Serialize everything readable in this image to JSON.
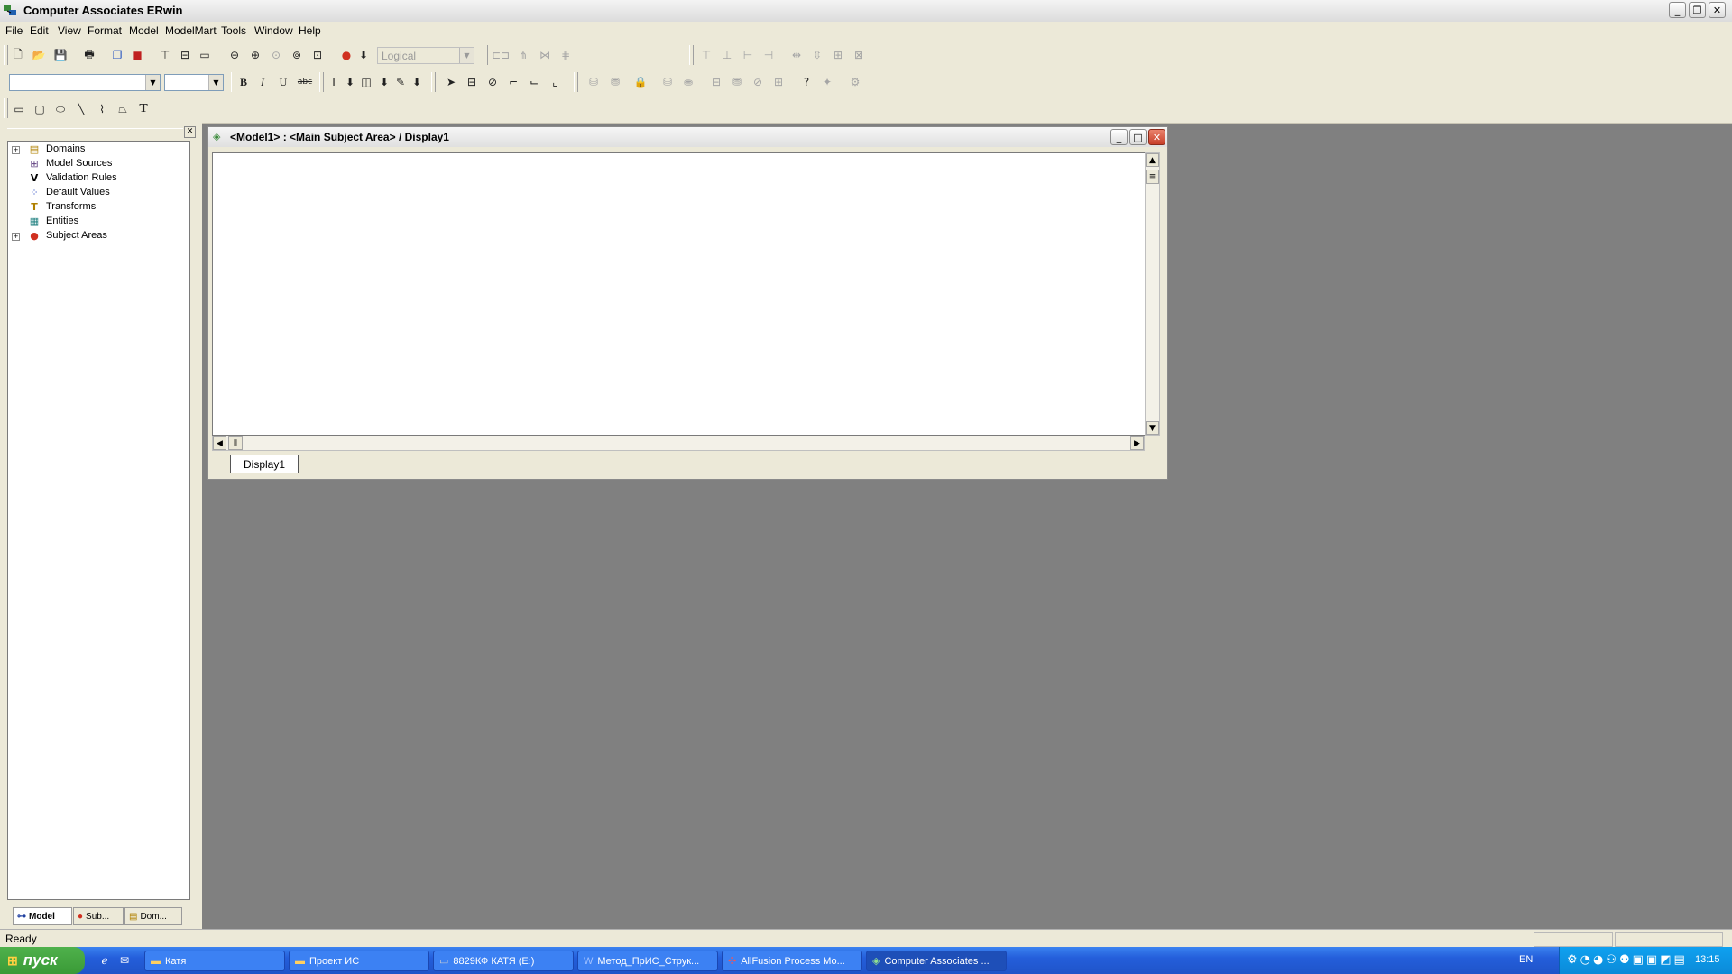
{
  "window": {
    "title": "Computer Associates ERwin",
    "app_icon": "erwin-app-icon",
    "controls": {
      "minimize": "_",
      "restore": "❐",
      "close": "✕"
    }
  },
  "menu": [
    "File",
    "Edit",
    "View",
    "Format",
    "Model",
    "ModelMart",
    "Tools",
    "Window",
    "Help"
  ],
  "toolbar": {
    "model_type_select": "Logical"
  },
  "tree": {
    "items": [
      {
        "label": "Domains",
        "expandable": true,
        "icon": "domains-icon"
      },
      {
        "label": "Model Sources",
        "expandable": false,
        "icon": "model-sources-icon"
      },
      {
        "label": "Validation Rules",
        "expandable": false,
        "icon": "validation-rules-icon"
      },
      {
        "label": "Default Values",
        "expandable": false,
        "icon": "default-values-icon"
      },
      {
        "label": "Transforms",
        "expandable": false,
        "icon": "transforms-icon"
      },
      {
        "label": "Entities",
        "expandable": false,
        "icon": "entities-icon"
      },
      {
        "label": "Subject Areas",
        "expandable": true,
        "icon": "subject-areas-icon"
      }
    ],
    "tabs": [
      "Model",
      "Sub...",
      "Dom..."
    ]
  },
  "diagram_window": {
    "title": "<Model1> : <Main Subject Area> / Display1",
    "tab": "Display1"
  },
  "status": {
    "text": "Ready"
  },
  "taskbar": {
    "start": "пуск",
    "tasks": [
      {
        "label": "Катя",
        "icon": "folder-icon"
      },
      {
        "label": "Проект ИС",
        "icon": "folder-icon"
      },
      {
        "label": "8829КФ КАТЯ (E:)",
        "icon": "drive-icon"
      },
      {
        "label": "Метод_ПрИС_Струк...",
        "icon": "word-doc-icon"
      },
      {
        "label": "AllFusion Process Mo...",
        "icon": "allfusion-icon"
      },
      {
        "label": "Computer Associates ...",
        "icon": "erwin-app-icon"
      }
    ],
    "lang": "EN",
    "clock": "13:15"
  }
}
